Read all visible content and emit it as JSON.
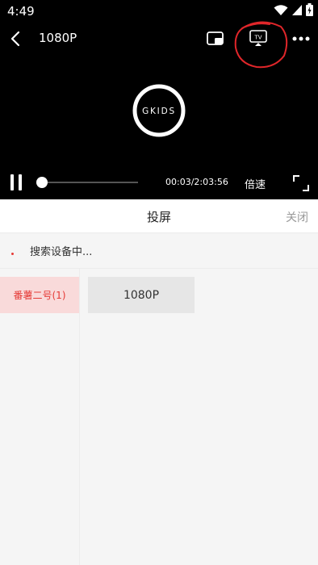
{
  "status_bar": {
    "time": "4:49",
    "icons": [
      "wifi-icon",
      "signal-icon",
      "battery-icon"
    ]
  },
  "player": {
    "title": "1080P",
    "logo_text": "GKIDS",
    "time_readout": "00:03/2:03:56",
    "speed_label": "倍速",
    "progress": 0.0,
    "toolbar_icons": [
      "back-icon",
      "pip-icon",
      "tv-cast-icon",
      "more-icon"
    ],
    "annotation_color": "#e0262a"
  },
  "cast_panel": {
    "title": "投屏",
    "close_label": "关闭",
    "searching_text": "搜索设备中...",
    "sources": [
      {
        "label": "番薯二号(1)",
        "selected": true
      }
    ],
    "qualities": [
      {
        "label": "1080P"
      }
    ]
  },
  "colors": {
    "accent": "#e53935",
    "selected_bg": "#f9dada",
    "player_bg": "#000000",
    "panel_bg": "#f5f5f5"
  }
}
